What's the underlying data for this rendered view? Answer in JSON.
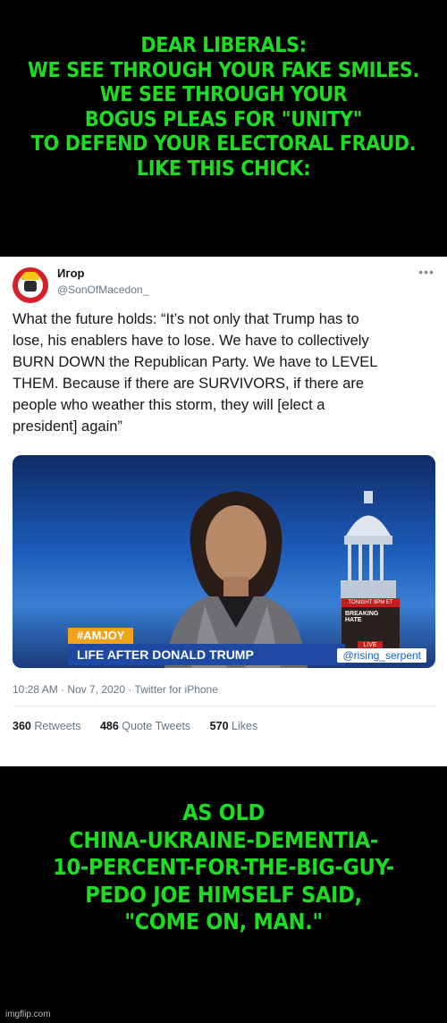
{
  "top_caption": [
    "DEAR LIBERALS:",
    "WE SEE THROUGH YOUR FAKE SMILES.",
    "WE SEE THROUGH YOUR",
    "BOGUS PLEAS FOR \"UNITY\"",
    "TO DEFEND YOUR ELECTORAL FRAUD.",
    "LIKE THIS CHICK:"
  ],
  "tweet": {
    "name": "Игор",
    "handle": "@SonOfMacedon_",
    "more": "•••",
    "body": [
      "What the future holds: “It’s not only that Trump has to",
      "lose, his enablers have to lose. We have to collectively",
      "BURN DOWN the Republican Party. We have to LEVEL",
      "THEM. Because if there are SURVIVORS, if there are",
      "people who weather this storm, they will [elect a",
      "president] again”"
    ],
    "media": {
      "tag": "#AMJOY",
      "banner": "LIFE AFTER DONALD TRUMP",
      "inset_top": "TONIGHT 9PM ET",
      "inset_title": "BREAKING HATE",
      "inset_live": "LIVE",
      "watermark": "@rising_serpent"
    },
    "meta": "10:28 AM · Nov 7, 2020 · Twitter for iPhone",
    "stats": {
      "retweets_count": "360",
      "retweets_label": "Retweets",
      "quotes_count": "486",
      "quotes_label": "Quote Tweets",
      "likes_count": "570",
      "likes_label": "Likes"
    }
  },
  "bottom_caption": [
    "AS OLD",
    "CHINA-UKRAINE-DEMENTIA-",
    "10-PERCENT-FOR-THE-BIG-GUY-",
    "PEDO JOE HIMSELF SAID,",
    "\"COME ON, MAN.\""
  ],
  "footer": "imgflip.com",
  "colors": {
    "caption": "#1ddc22",
    "background": "#000000",
    "banner": "#1f48a3",
    "tag": "#f0a21a"
  }
}
